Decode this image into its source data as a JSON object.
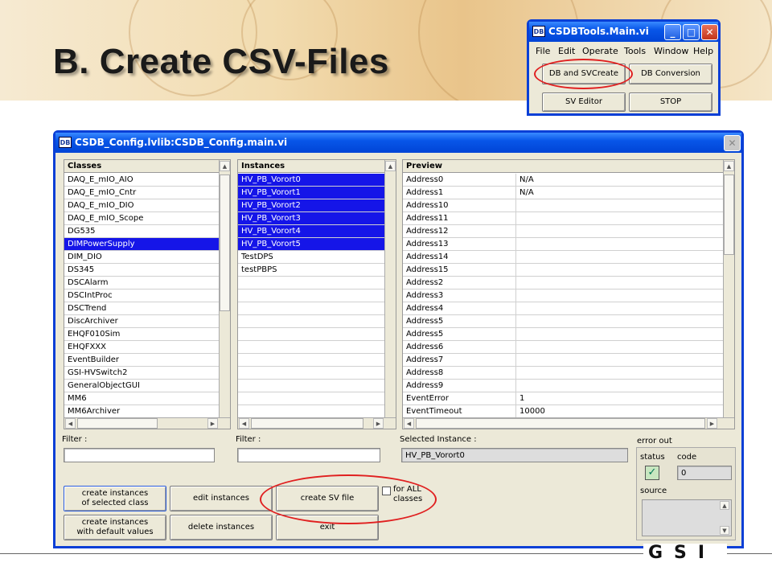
{
  "slide": {
    "title": "B. Create CSV-Files"
  },
  "tools_window": {
    "title": "CSDBTools.Main.vi",
    "icon_text": "DB",
    "menu": [
      "File",
      "Edit",
      "Operate",
      "Tools",
      "Window",
      "Help"
    ],
    "buttons": {
      "db_svcreate": "DB and SVCreate",
      "db_conversion": "DB Conversion",
      "sv_editor": "SV Editor",
      "stop": "STOP"
    }
  },
  "config_window": {
    "title": "CSDB_Config.lvlib:CSDB_Config.main.vi",
    "icon_text": "DB",
    "classes": {
      "header": "Classes",
      "items": [
        "DAQ_E_mIO_AIO",
        "DAQ_E_mIO_Cntr",
        "DAQ_E_mIO_DIO",
        "DAQ_E_mIO_Scope",
        "DG535",
        "DIMPowerSupply",
        "DIM_DIO",
        "DS345",
        "DSCAlarm",
        "DSCIntProc",
        "DSCTrend",
        "DiscArchiver",
        "EHQF010Sim",
        "EHQFXXX",
        "EventBuilder",
        "GSI-HVSwitch2",
        "GeneralObjectGUI",
        "MM6",
        "MM6Archiver"
      ],
      "selected": 5
    },
    "instances": {
      "header": "Instances",
      "items": [
        "HV_PB_Vorort0",
        "HV_PB_Vorort1",
        "HV_PB_Vorort2",
        "HV_PB_Vorort3",
        "HV_PB_Vorort4",
        "HV_PB_Vorort5",
        "TestDPS",
        "testPBPS"
      ],
      "selected": [
        0,
        1,
        2,
        3,
        4,
        5
      ]
    },
    "preview": {
      "header": "Preview",
      "rows": [
        [
          "Address0",
          "N/A"
        ],
        [
          "Address1",
          "N/A"
        ],
        [
          "Address10",
          ""
        ],
        [
          "Address11",
          ""
        ],
        [
          "Address12",
          ""
        ],
        [
          "Address13",
          ""
        ],
        [
          "Address14",
          ""
        ],
        [
          "Address15",
          ""
        ],
        [
          "Address2",
          ""
        ],
        [
          "Address3",
          ""
        ],
        [
          "Address4",
          ""
        ],
        [
          "Address5",
          ""
        ],
        [
          "Address5",
          ""
        ],
        [
          "Address6",
          ""
        ],
        [
          "Address7",
          ""
        ],
        [
          "Address8",
          ""
        ],
        [
          "Address9",
          ""
        ],
        [
          "EventError",
          "1"
        ],
        [
          "EventTimeout",
          "10000"
        ]
      ]
    },
    "filter_label_1": "Filter :",
    "filter_label_2": "Filter :",
    "filter_value_1": "",
    "filter_value_2": "",
    "selected_instance_label": "Selected Instance :",
    "selected_instance_value": "HV_PB_Vorort0",
    "error_out": {
      "label": "error out",
      "status_label": "status",
      "code_label": "code",
      "code_value": "0",
      "source_label": "source",
      "status_check": "✓"
    },
    "buttons": {
      "create_selected": [
        "create instances",
        "of selected class"
      ],
      "edit": "edit instances",
      "create_sv": "create SV file",
      "create_default": [
        "create instances",
        "with default values"
      ],
      "delete": "delete instances",
      "exit": "exit"
    },
    "for_all": [
      "for ALL",
      "classes"
    ]
  },
  "footer": {
    "logo": "GSI"
  },
  "colors": {
    "selection": "#1515e8",
    "titlebar": "#0856e8",
    "highlight_oval": "#e02020"
  }
}
